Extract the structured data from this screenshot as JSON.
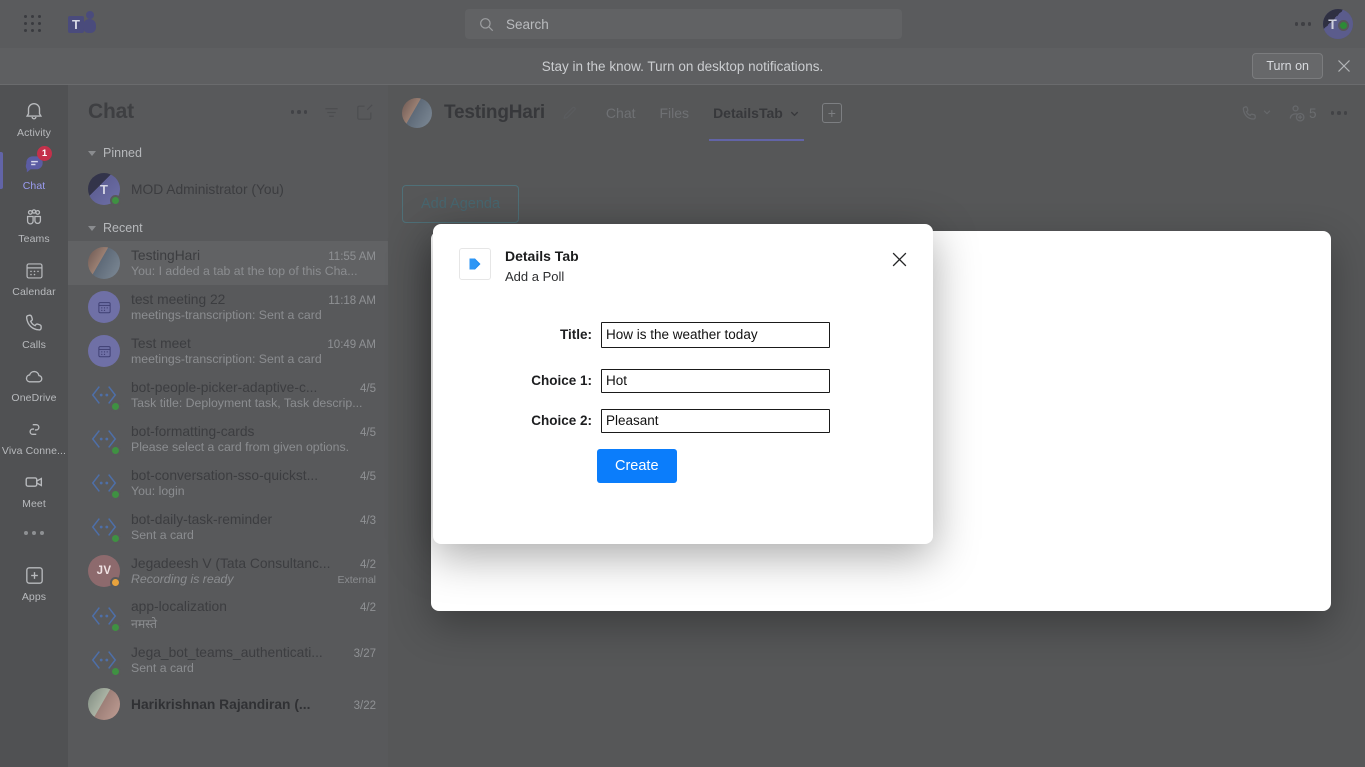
{
  "topbar": {
    "waffle_icon": "app-launcher-grid-icon",
    "logo_text": "T",
    "search": {
      "placeholder": "Search",
      "icon": "search-icon"
    },
    "more_icon": "more-horizontal-icon",
    "avatar_initial": "T"
  },
  "banner": {
    "message": "Stay in the know. Turn on desktop notifications.",
    "button_label": "Turn on",
    "close_icon": "close-icon"
  },
  "rail": {
    "items": [
      {
        "label": "Activity",
        "icon": "bell-icon",
        "active": false,
        "badge": ""
      },
      {
        "label": "Chat",
        "icon": "chat-bubble-icon",
        "active": true,
        "badge": "1"
      },
      {
        "label": "Teams",
        "icon": "teams-people-icon",
        "active": false,
        "badge": ""
      },
      {
        "label": "Calendar",
        "icon": "calendar-icon",
        "active": false,
        "badge": ""
      },
      {
        "label": "Calls",
        "icon": "phone-icon",
        "active": false,
        "badge": ""
      },
      {
        "label": "OneDrive",
        "icon": "cloud-icon",
        "active": false,
        "badge": ""
      },
      {
        "label": "Viva Conne...",
        "icon": "viva-connections-icon",
        "active": false,
        "badge": ""
      },
      {
        "label": "Meet",
        "icon": "video-camera-icon",
        "active": false,
        "badge": ""
      }
    ],
    "more_icon": "more-horizontal-icon",
    "apps": {
      "label": "Apps",
      "icon": "plus-square-icon"
    }
  },
  "chatpanel": {
    "title": "Chat",
    "icons": [
      "more-horizontal-icon",
      "filter-icon",
      "compose-new-chat-icon"
    ],
    "groups": [
      {
        "name": "Pinned"
      },
      {
        "name": "Recent"
      }
    ],
    "pinned": [
      {
        "name": "MOD Administrator (You)",
        "time": "",
        "preview": "",
        "avatar": "img2",
        "presence": "available"
      }
    ],
    "recent": [
      {
        "name": "TestingHari",
        "time": "11:55 AM",
        "preview": "You: I added a tab at the top of this Cha...",
        "avatar": "img1",
        "selected": true,
        "presence": ""
      },
      {
        "name": "test meeting 22",
        "time": "11:18 AM",
        "preview": "meetings-transcription: Sent a card",
        "avatar": "meet",
        "presence": ""
      },
      {
        "name": "Test meet",
        "time": "10:49 AM",
        "preview": "meetings-transcription: Sent a card",
        "avatar": "meet",
        "presence": ""
      },
      {
        "name": "bot-people-picker-adaptive-c...",
        "time": "4/5",
        "preview": "Task title: Deployment task, Task descrip...",
        "avatar": "bot",
        "presence": "available"
      },
      {
        "name": "bot-formatting-cards",
        "time": "4/5",
        "preview": "Please select a card from given options.",
        "avatar": "bot",
        "presence": "available"
      },
      {
        "name": "bot-conversation-sso-quickst...",
        "time": "4/5",
        "preview": "You: login",
        "avatar": "bot",
        "presence": "available"
      },
      {
        "name": "bot-daily-task-reminder",
        "time": "4/3",
        "preview": "Sent a card",
        "avatar": "bot",
        "presence": "available"
      },
      {
        "name": "Jegadeesh V (Tata Consultanc...",
        "time": "4/2",
        "preview": "Recording is ready",
        "avatar": "JV",
        "presence": "away",
        "external": "External",
        "italic": true
      },
      {
        "name": "app-localization",
        "time": "4/2",
        "preview": "नमस्ते",
        "avatar": "bot",
        "presence": "available"
      },
      {
        "name": "Jega_bot_teams_authenticati...",
        "time": "3/27",
        "preview": "Sent a card",
        "avatar": "bot",
        "presence": "available"
      },
      {
        "name": "Harikrishnan Rajandiran (...",
        "time": "3/22",
        "preview": "",
        "avatar": "img3",
        "bold": true,
        "presence": ""
      }
    ]
  },
  "main": {
    "chat_title": "TestingHari",
    "edit_icon": "pencil-icon",
    "tabs": [
      {
        "label": "Chat",
        "active": false,
        "dropdown": false
      },
      {
        "label": "Files",
        "active": false,
        "dropdown": false
      },
      {
        "label": "DetailsTab",
        "active": true,
        "dropdown": true
      }
    ],
    "add_tab_icon": "add-tab-plus-icon",
    "call_icon": "phone-call-icon",
    "call_chevron_icon": "chevron-down-icon",
    "people_icon": "add-people-icon",
    "people_count": "5",
    "more_icon": "more-horizontal-icon",
    "agenda_button": "Add Agenda"
  },
  "modal": {
    "app_icon": "details-tab-app-icon",
    "title": "Details Tab",
    "subtitle": "Add a Poll",
    "close_icon": "close-icon",
    "fields": [
      {
        "label": "Title:",
        "value": "How is the weather today",
        "name": "title-input"
      },
      {
        "label": "Choice 1:",
        "value": "Hot",
        "name": "choice-1-input"
      },
      {
        "label": "Choice 2:",
        "value": "Pleasant",
        "name": "choice-2-input"
      }
    ],
    "submit_label": "Create"
  },
  "colors": {
    "accent_purple": "#6264a7",
    "create_blue": "#0b7dfb",
    "badge_red": "#c4314b",
    "presence_green": "#3f9142",
    "presence_away": "#e8a33d"
  }
}
